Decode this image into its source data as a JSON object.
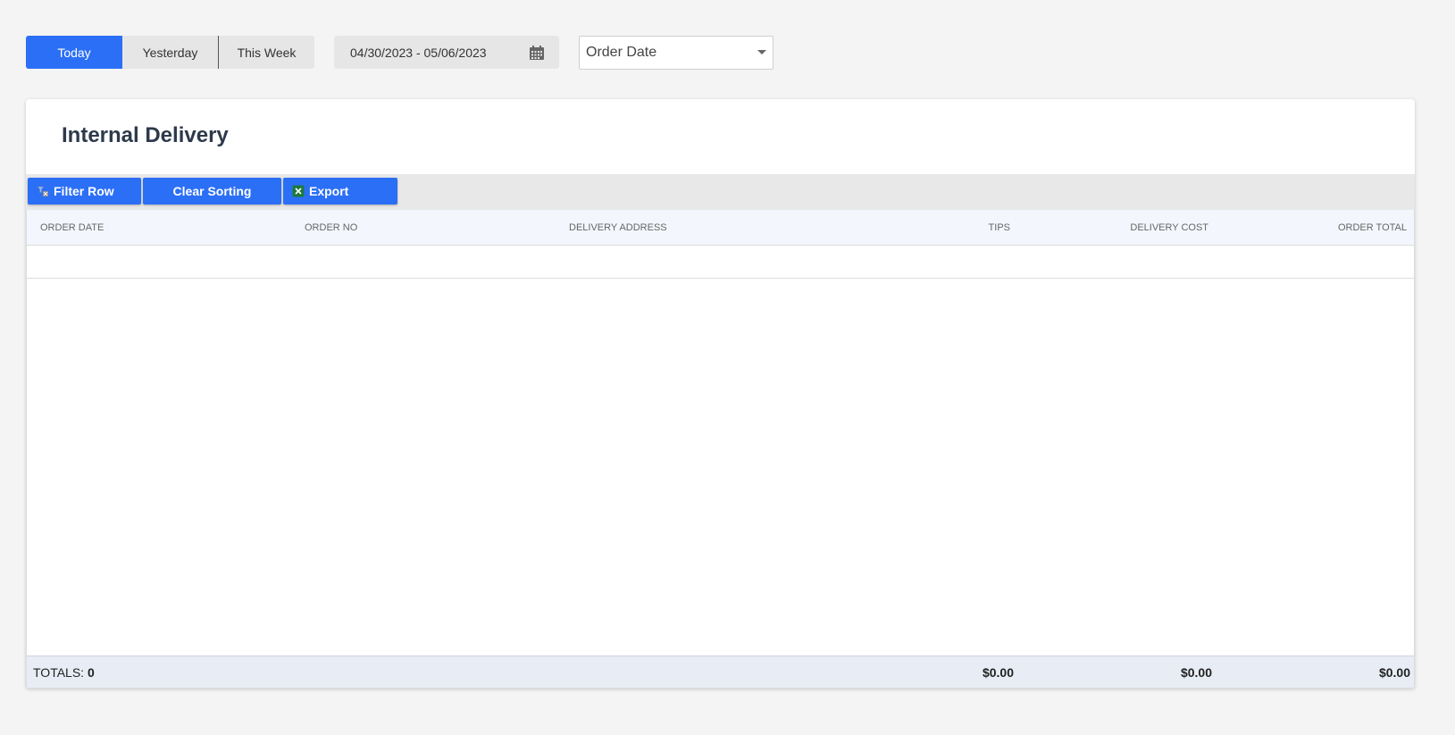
{
  "period_buttons": [
    {
      "label": "Today",
      "active": true
    },
    {
      "label": "Yesterday",
      "active": false
    },
    {
      "label": "This Week",
      "active": false
    }
  ],
  "date_range": {
    "value": "04/30/2023 - 05/06/2023",
    "icon": "calendar-icon"
  },
  "date_type_select": {
    "selected": "Order Date"
  },
  "card": {
    "title": "Internal Delivery",
    "toolbar": {
      "filter_row": "Filter Row",
      "clear_sorting": "Clear Sorting",
      "export": "Export"
    },
    "columns": [
      "ORDER DATE",
      "ORDER NO",
      "DELIVERY ADDRESS",
      "TIPS",
      "DELIVERY COST",
      "ORDER TOTAL"
    ],
    "rows": [],
    "totals": {
      "label": "TOTALS:",
      "count": "0",
      "tips": "$0.00",
      "delivery_cost": "$0.00",
      "order_total": "$0.00"
    }
  },
  "colors": {
    "accent": "#2b6ff6",
    "toolbar_bg": "#e8e8e8",
    "header_bg": "#f3f7fd",
    "footer_bg": "#e8edf5"
  }
}
